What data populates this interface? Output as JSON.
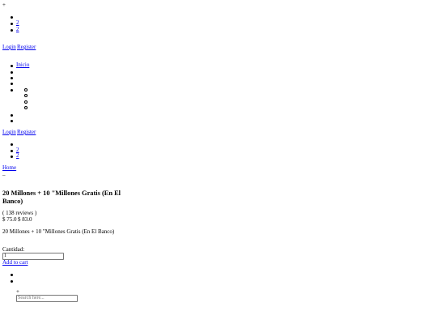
{
  "header": {
    "plus_glyph": "+",
    "cart_counts": [
      "2",
      "2"
    ],
    "auth": {
      "login": "Login",
      "register": "Register"
    }
  },
  "nav": {
    "home": "Inicio"
  },
  "nav_auth": {
    "login": "Login",
    "register": "Register"
  },
  "mini_counts": [
    "2",
    "2"
  ],
  "breadcrumb": {
    "home": "Home",
    "separator": "–"
  },
  "product": {
    "title": "20 Millones + 10 \"Millones Gratis (En El Banco)",
    "reviews": "( 138 reviews )",
    "price": "$ 75.0",
    "old_price": "$ 83.0",
    "description": "20 Millones + 10 \"Millones Gratis (En El Banco)",
    "quantity_label": "Cantidad:",
    "quantity_value": "1",
    "add_to_cart": "Add to cart"
  },
  "search": {
    "plus_glyph": "+",
    "placeholder": "Search here..."
  }
}
